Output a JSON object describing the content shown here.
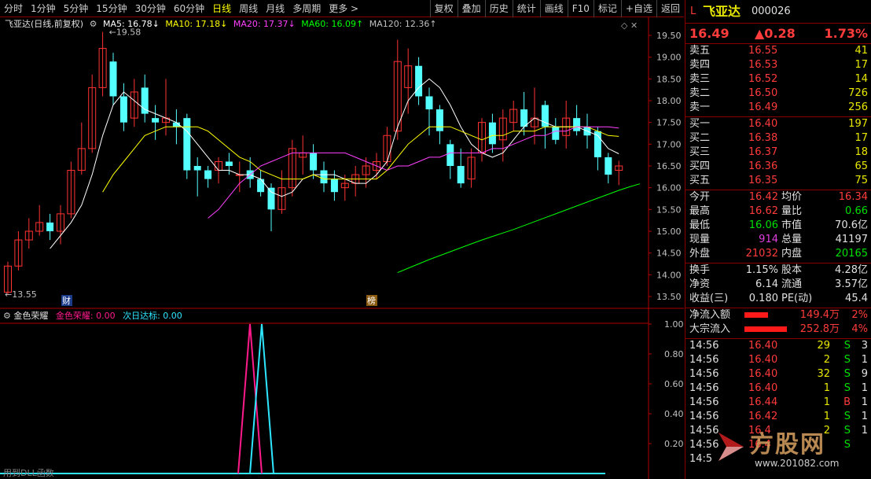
{
  "toolbar": {
    "left": [
      "分时",
      "1分钟",
      "5分钟",
      "15分钟",
      "30分钟",
      "60分钟",
      "日线",
      "周线",
      "月线",
      "多周期",
      "更多 >"
    ],
    "active": "日线",
    "right": [
      "复权",
      "叠加",
      "历史",
      "统计",
      "画线",
      "F10",
      "标记",
      "+自选",
      "返回"
    ]
  },
  "chart_header": {
    "title": "飞亚达(日线,前复权)",
    "ma5": "MA5: 16.78↓",
    "ma10": "MA10: 17.18↓",
    "ma20": "MA20: 17.37↓",
    "ma60": "MA60: 16.09↑",
    "ma120": "MA120: 12.36↑"
  },
  "chart_labels": {
    "high_mark": "19.58",
    "low_mark": "13.55",
    "badge_cai": "财",
    "badge_bang": "榜",
    "watermark_bottom": "用到DLL函数"
  },
  "indicator_header": {
    "name": "金色荣耀",
    "line1": "金色荣耀: 0.00",
    "line2": "次日达标: 0.00"
  },
  "colors": {
    "up": "#ff3232",
    "down": "#54ffff",
    "ma5": "#ffffff",
    "ma10": "#ffff00",
    "ma20": "#ff40ff",
    "ma60": "#00ff00",
    "axis": "#b00000",
    "ind1": "#ff1a8c",
    "ind2": "#2ee6ff"
  },
  "chart_data": {
    "type": "candlestick",
    "y_ticks": [
      "19.50",
      "19.00",
      "18.50",
      "18.00",
      "17.50",
      "17.00",
      "16.50",
      "16.00",
      "15.50",
      "15.00",
      "14.50",
      "14.00",
      "13.50"
    ],
    "ylim": [
      13.3,
      19.65
    ],
    "candles": [
      [
        13.6,
        14.2,
        13.55,
        14.3
      ],
      [
        14.2,
        14.8,
        14.1,
        15.0
      ],
      [
        14.8,
        15.0,
        14.6,
        15.3
      ],
      [
        15.0,
        15.2,
        14.9,
        15.6
      ],
      [
        15.2,
        15.0,
        14.8,
        15.4
      ],
      [
        15.0,
        15.4,
        14.7,
        15.6
      ],
      [
        15.4,
        16.4,
        15.3,
        16.6
      ],
      [
        16.4,
        16.9,
        16.3,
        17.5
      ],
      [
        16.9,
        18.3,
        16.8,
        18.6
      ],
      [
        18.3,
        19.2,
        18.1,
        19.58
      ],
      [
        18.9,
        18.1,
        17.9,
        19.1
      ],
      [
        18.1,
        17.5,
        17.3,
        18.4
      ],
      [
        17.6,
        18.2,
        17.4,
        18.5
      ],
      [
        18.3,
        17.7,
        17.5,
        18.6
      ],
      [
        17.6,
        17.5,
        17.1,
        17.9
      ],
      [
        17.5,
        17.6,
        17.2,
        18.5
      ],
      [
        17.5,
        17.4,
        17.0,
        17.8
      ],
      [
        17.6,
        16.4,
        16.2,
        17.7
      ],
      [
        16.5,
        16.4,
        15.8,
        16.7
      ],
      [
        16.4,
        16.2,
        16.0,
        16.5
      ],
      [
        16.4,
        16.6,
        16.1,
        16.7
      ],
      [
        16.6,
        16.5,
        16.3,
        16.8
      ],
      [
        16.3,
        16.3,
        15.9,
        16.6
      ],
      [
        16.4,
        16.2,
        16.0,
        16.7
      ],
      [
        16.2,
        15.9,
        15.8,
        16.4
      ],
      [
        16.0,
        15.5,
        15.0,
        16.1
      ],
      [
        15.5,
        16.0,
        15.4,
        16.4
      ],
      [
        16.0,
        16.9,
        15.8,
        17.1
      ],
      [
        16.7,
        16.8,
        16.3,
        17.2
      ],
      [
        16.8,
        16.4,
        16.2,
        17.0
      ],
      [
        16.4,
        16.1,
        15.9,
        16.6
      ],
      [
        16.2,
        15.9,
        15.7,
        16.4
      ],
      [
        16.0,
        16.1,
        15.7,
        16.3
      ],
      [
        16.1,
        16.3,
        15.8,
        16.5
      ],
      [
        16.3,
        16.5,
        16.0,
        16.7
      ],
      [
        16.4,
        16.6,
        16.2,
        16.8
      ],
      [
        16.6,
        17.2,
        16.5,
        17.4
      ],
      [
        17.3,
        18.9,
        17.1,
        19.4
      ],
      [
        18.3,
        18.8,
        17.7,
        19.2
      ],
      [
        18.8,
        18.1,
        17.9,
        19.0
      ],
      [
        18.1,
        17.8,
        17.2,
        18.3
      ],
      [
        17.8,
        17.3,
        17.0,
        17.9
      ],
      [
        17.0,
        16.5,
        16.2,
        17.1
      ],
      [
        16.5,
        16.1,
        16.0,
        16.9
      ],
      [
        16.2,
        16.7,
        16.0,
        16.9
      ],
      [
        16.8,
        17.5,
        16.6,
        17.6
      ],
      [
        17.5,
        17.0,
        16.8,
        17.7
      ],
      [
        17.1,
        17.6,
        16.6,
        17.8
      ],
      [
        17.5,
        17.8,
        17.3,
        18.0
      ],
      [
        17.8,
        17.4,
        17.2,
        18.2
      ],
      [
        17.4,
        17.6,
        17.0,
        18.3
      ],
      [
        17.9,
        17.4,
        16.9,
        18.0
      ],
      [
        17.4,
        17.1,
        17.0,
        17.6
      ],
      [
        17.2,
        17.6,
        16.9,
        18.0
      ],
      [
        17.6,
        17.3,
        17.2,
        17.9
      ],
      [
        17.4,
        17.2,
        16.9,
        17.7
      ],
      [
        17.3,
        16.7,
        16.4,
        17.4
      ],
      [
        16.7,
        16.3,
        16.1,
        16.8
      ],
      [
        16.4,
        16.5,
        16.06,
        16.62
      ]
    ],
    "ma5": [
      null,
      null,
      null,
      null,
      14.6,
      14.9,
      15.2,
      15.6,
      16.3,
      17.2,
      17.9,
      18.2,
      18.0,
      17.8,
      17.7,
      17.6,
      17.5,
      17.3,
      17.0,
      16.7,
      16.4,
      16.4,
      16.3,
      16.3,
      16.2,
      15.9,
      15.8,
      15.9,
      16.2,
      16.3,
      16.3,
      16.3,
      16.2,
      16.1,
      16.1,
      16.3,
      16.6,
      17.4,
      18.0,
      18.3,
      18.5,
      18.3,
      17.9,
      17.4,
      17.0,
      16.8,
      16.7,
      16.8,
      17.1,
      17.4,
      17.6,
      17.5,
      17.4,
      17.4,
      17.4,
      17.3,
      17.2,
      16.9,
      16.78
    ],
    "ma10": [
      null,
      null,
      null,
      null,
      null,
      null,
      null,
      null,
      null,
      15.9,
      16.3,
      16.6,
      16.9,
      17.2,
      17.3,
      17.4,
      17.4,
      17.4,
      17.4,
      17.3,
      17.1,
      16.9,
      16.7,
      16.6,
      16.4,
      16.3,
      16.2,
      16.2,
      16.2,
      16.3,
      16.2,
      16.2,
      16.2,
      16.2,
      16.2,
      16.2,
      16.4,
      16.7,
      17.0,
      17.2,
      17.4,
      17.4,
      17.4,
      17.3,
      17.2,
      17.1,
      17.2,
      17.2,
      17.3,
      17.3,
      17.3,
      17.4,
      17.4,
      17.4,
      17.4,
      17.4,
      17.3,
      17.2,
      17.18
    ],
    "ma20": [
      null,
      null,
      null,
      null,
      null,
      null,
      null,
      null,
      null,
      null,
      null,
      null,
      null,
      null,
      null,
      null,
      null,
      null,
      null,
      15.3,
      15.5,
      15.8,
      16.1,
      16.3,
      16.5,
      16.6,
      16.7,
      16.8,
      16.8,
      16.8,
      16.8,
      16.8,
      16.8,
      16.7,
      16.6,
      16.5,
      16.4,
      16.5,
      16.5,
      16.6,
      16.7,
      16.7,
      16.8,
      16.8,
      16.8,
      16.8,
      16.9,
      16.9,
      17.0,
      17.1,
      17.2,
      17.2,
      17.3,
      17.3,
      17.4,
      17.4,
      17.4,
      17.4,
      17.37
    ],
    "ma60_start": 37,
    "ma60": [
      14.05,
      14.15,
      14.25,
      14.35,
      14.44,
      14.53,
      14.62,
      14.71,
      14.8,
      14.88,
      14.96,
      15.04,
      15.13,
      15.22,
      15.31,
      15.4,
      15.49,
      15.58,
      15.67,
      15.76,
      15.85,
      15.94,
      16.02,
      16.09
    ]
  },
  "indicator": {
    "y_ticks": [
      "1.00",
      "0.80",
      "0.60",
      "0.40",
      "0.20"
    ],
    "signal1_index": 25,
    "signal2_index": 26
  },
  "quote": {
    "prefix": "L",
    "name": "飞亚达",
    "code": "000026",
    "price": "16.49",
    "change": "▲0.28",
    "pct": "1.73%",
    "asks": [
      {
        "label": "卖五",
        "price": "16.55",
        "vol": "41"
      },
      {
        "label": "卖四",
        "price": "16.53",
        "vol": "17"
      },
      {
        "label": "卖三",
        "price": "16.52",
        "vol": "14"
      },
      {
        "label": "卖二",
        "price": "16.50",
        "vol": "726"
      },
      {
        "label": "卖一",
        "price": "16.49",
        "vol": "256"
      }
    ],
    "bids": [
      {
        "label": "买一",
        "price": "16.40",
        "vol": "197"
      },
      {
        "label": "买二",
        "price": "16.38",
        "vol": "17"
      },
      {
        "label": "买三",
        "price": "16.37",
        "vol": "18"
      },
      {
        "label": "买四",
        "price": "16.36",
        "vol": "65"
      },
      {
        "label": "买五",
        "price": "16.35",
        "vol": "75"
      }
    ],
    "stats": [
      {
        "l1": "今开",
        "v1": "16.42",
        "c1": "red",
        "l2": "均价",
        "v2": "16.34",
        "c2": "red"
      },
      {
        "l1": "最高",
        "v1": "16.62",
        "c1": "red",
        "l2": "量比",
        "v2": "0.66",
        "c2": "grn"
      },
      {
        "l1": "最低",
        "v1": "16.06",
        "c1": "grn",
        "l2": "市值",
        "v2": "70.6亿",
        "c2": "wht"
      },
      {
        "l1": "现量",
        "v1": "914",
        "c1": "mag",
        "l2": "总量",
        "v2": "41197",
        "c2": "wht"
      },
      {
        "l1": "外盘",
        "v1": "21032",
        "c1": "red",
        "l2": "内盘",
        "v2": "20165",
        "c2": "grn"
      }
    ],
    "stats2": [
      {
        "l1": "换手",
        "v1": "1.15%",
        "l2": "股本",
        "v2": "4.28亿"
      },
      {
        "l1": "净资",
        "v1": "6.14",
        "l2": "流通",
        "v2": "3.57亿"
      },
      {
        "l1": "收益(三)",
        "v1": "0.180",
        "l2": "PE(动)",
        "v2": "45.4"
      }
    ],
    "flows": [
      {
        "label": "净流入额",
        "value": "149.4万",
        "pct": "2%"
      },
      {
        "label": "大宗流入",
        "value": "252.8万",
        "pct": "4%"
      }
    ],
    "ticks": [
      {
        "time": "14:56",
        "price": "16.40",
        "vol": "29",
        "side": "S",
        "n": "3"
      },
      {
        "time": "14:56",
        "price": "16.40",
        "vol": "2",
        "side": "S",
        "n": "1"
      },
      {
        "time": "14:56",
        "price": "16.40",
        "vol": "32",
        "side": "S",
        "n": "9"
      },
      {
        "time": "14:56",
        "price": "16.40",
        "vol": "1",
        "side": "S",
        "n": "1"
      },
      {
        "time": "14:56",
        "price": "16.44",
        "vol": "1",
        "side": "B",
        "n": "1"
      },
      {
        "time": "14:56",
        "price": "16.42",
        "vol": "1",
        "side": "S",
        "n": "1"
      },
      {
        "time": "14:56",
        "price": "16.4",
        "vol": "2",
        "side": "S",
        "n": "1"
      },
      {
        "time": "14:56",
        "price": "16.4",
        "vol": "",
        "side": "S",
        "n": ""
      },
      {
        "time": "14:5",
        "price": "",
        "vol": "",
        "side": "",
        "n": ""
      }
    ],
    "watermark": "方股网",
    "watermark_url": "www.201082.com"
  }
}
